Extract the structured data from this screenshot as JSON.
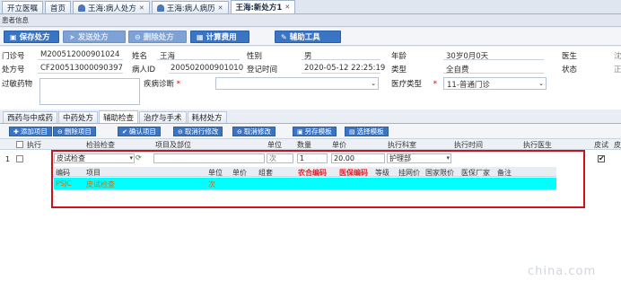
{
  "tabs": [
    {
      "label": "开立医嘱",
      "closable": false,
      "icon": false
    },
    {
      "label": "首页",
      "closable": false,
      "icon": false
    },
    {
      "label": "王海:病人处方",
      "closable": true,
      "icon": true
    },
    {
      "label": "王海:病人病历",
      "closable": true,
      "icon": true
    },
    {
      "label": "王海:新处方1",
      "closable": true,
      "icon": false,
      "active": true
    }
  ],
  "info_bar": "患者信息",
  "toolbar": {
    "save": "保存处方",
    "send": "发送处方",
    "delete": "删除处方",
    "calc": "计算费用",
    "tools": "辅助工具"
  },
  "form": {
    "clinic_no_label": "门诊号",
    "clinic_no": "M200512000901024",
    "name_label": "姓名",
    "name": "王海",
    "gender_label": "性别",
    "gender": "男",
    "age_label": "年龄",
    "age": "30岁0月0天",
    "doctor_label": "医生",
    "doctor": "沈",
    "rx_no_label": "处方号",
    "rx_no": "CF200513000090397",
    "patient_id_label": "病人ID",
    "patient_id": "200502000901010",
    "reg_time_label": "登记时间",
    "reg_time": "2020-05-12 22:25:19",
    "type_label": "类型",
    "type": "全自费",
    "status_label": "状态",
    "status": "正",
    "allergy_label": "过敏药物",
    "diagnosis_label": "疾病诊断",
    "med_type_label": "医疗类型",
    "med_type": "11-普通门诊"
  },
  "subtabs": [
    "西药与中成药",
    "中药处方",
    "辅助检查",
    "治疗与手术",
    "耗材处方"
  ],
  "active_subtab": 2,
  "order_toolbar": {
    "add": "添加项目",
    "delete": "删除项目",
    "confirm": "确认项目",
    "cancel_edit": "取消行修改",
    "cancel_mod": "取消修改",
    "save_tpl": "另存模板",
    "pick_tpl": "选择模板"
  },
  "grid_headers": [
    "执行",
    "检验检查",
    "项目及部位",
    "单位",
    "数量",
    "单价",
    "执行科室",
    "执行时间",
    "执行医生",
    "皮试",
    "皮"
  ],
  "row": {
    "num": "1",
    "item": "皮试检查",
    "unit": "次",
    "qty": "1",
    "price": "20.00",
    "dept": "护理部"
  },
  "suggest": {
    "headers": [
      "编码",
      "项目",
      "单位",
      "单价",
      "组套",
      "农合编码",
      "医保编码",
      "等级",
      "挂网价",
      "国家限价",
      "医保厂家",
      "备注"
    ],
    "row": {
      "code": "PSJC",
      "item": "皮试检查",
      "unit": "次"
    }
  },
  "watermark": "china.com"
}
